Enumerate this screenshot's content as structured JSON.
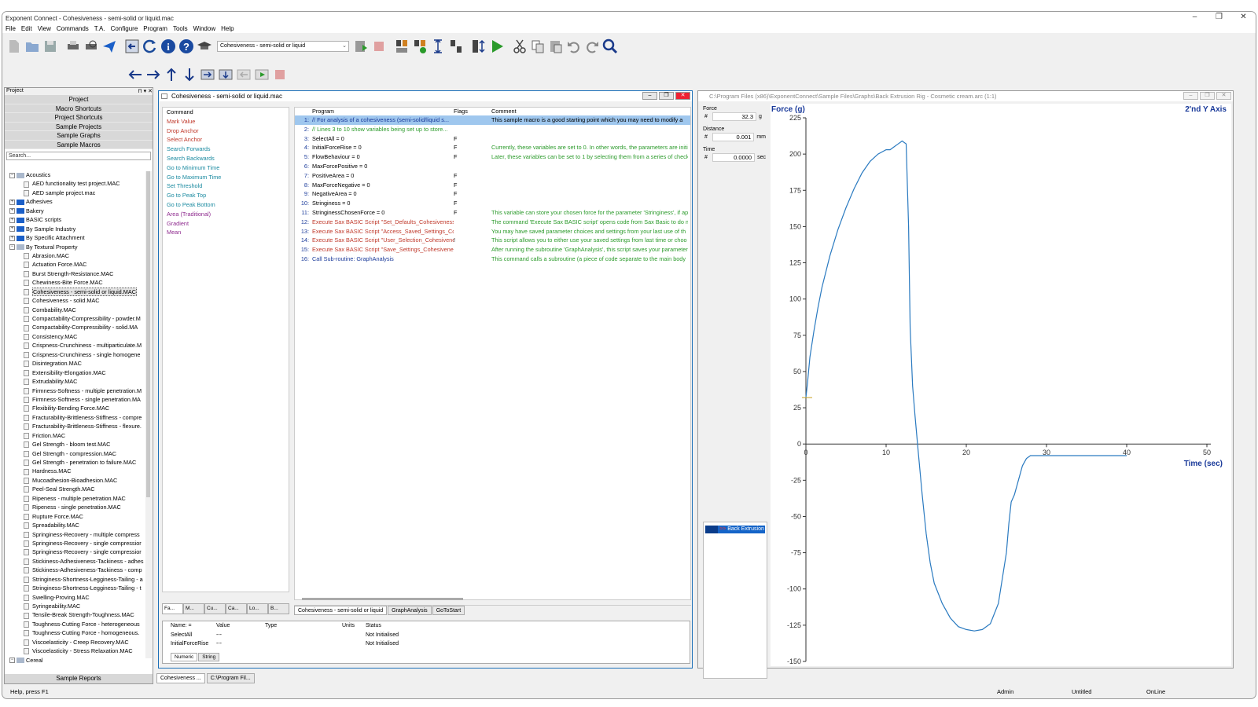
{
  "window": {
    "title": "Exponent Connect - Cohesiveness - semi-solid or liquid.mac"
  },
  "menu": [
    "File",
    "Edit",
    "View",
    "Commands",
    "T.A.",
    "Configure",
    "Program",
    "Tools",
    "Window",
    "Help"
  ],
  "toolbar": {
    "macro_select": "Cohesiveness - semi-solid or liquid"
  },
  "project": {
    "header": "Project",
    "buttons": [
      "Project",
      "Macro Shortcuts",
      "Project Shortcuts",
      "Sample Projects",
      "Sample Graphs",
      "Sample Macros"
    ],
    "search_placeholder": "Search...",
    "tree": [
      {
        "t": "Acoustics",
        "lv": 0,
        "k": "fo"
      },
      {
        "t": "AED functionality test project.MAC",
        "lv": 1,
        "k": "doc"
      },
      {
        "t": "AED sample project.mac",
        "lv": 1,
        "k": "doc"
      },
      {
        "t": "Adhesives",
        "lv": 0,
        "k": "fc"
      },
      {
        "t": "Bakery",
        "lv": 0,
        "k": "fc"
      },
      {
        "t": "BASIC scripts",
        "lv": 0,
        "k": "fc"
      },
      {
        "t": "By Sample Industry",
        "lv": 0,
        "k": "fc"
      },
      {
        "t": "By Specific Attachment",
        "lv": 0,
        "k": "fc"
      },
      {
        "t": "By Textural Property",
        "lv": 0,
        "k": "fo"
      },
      {
        "t": "Abrasion.MAC",
        "lv": 1,
        "k": "doc"
      },
      {
        "t": "Actuation Force.MAC",
        "lv": 1,
        "k": "doc"
      },
      {
        "t": "Burst Strength-Resistance.MAC",
        "lv": 1,
        "k": "doc"
      },
      {
        "t": "Chewiness-Bite Force.MAC",
        "lv": 1,
        "k": "doc"
      },
      {
        "t": "Cohesiveness - semi-solid or liquid.MAC",
        "lv": 1,
        "k": "doc",
        "sel": true
      },
      {
        "t": "Cohesiveness - solid.MAC",
        "lv": 1,
        "k": "doc"
      },
      {
        "t": "Combability.MAC",
        "lv": 1,
        "k": "doc"
      },
      {
        "t": "Compactability-Compressibility - powder.M",
        "lv": 1,
        "k": "doc"
      },
      {
        "t": "Compactability-Compressibility - solid.MA",
        "lv": 1,
        "k": "doc"
      },
      {
        "t": "Consistency.MAC",
        "lv": 1,
        "k": "doc"
      },
      {
        "t": "Crispness-Crunchiness - multiparticulate.M",
        "lv": 1,
        "k": "doc"
      },
      {
        "t": "Crispness-Crunchiness - single homogene",
        "lv": 1,
        "k": "doc"
      },
      {
        "t": "Disintegration.MAC",
        "lv": 1,
        "k": "doc"
      },
      {
        "t": "Extensibility-Elongation.MAC",
        "lv": 1,
        "k": "doc"
      },
      {
        "t": "Extrudability.MAC",
        "lv": 1,
        "k": "doc"
      },
      {
        "t": "Firmness-Softness - multiple penetration.M",
        "lv": 1,
        "k": "doc"
      },
      {
        "t": "Firmness-Softness - single penetration.MA",
        "lv": 1,
        "k": "doc"
      },
      {
        "t": "Flexibility-Bending Force.MAC",
        "lv": 1,
        "k": "doc"
      },
      {
        "t": "Fracturability-Brittleness-Stiffness - compre",
        "lv": 1,
        "k": "doc"
      },
      {
        "t": "Fracturability-Brittleness-Stiffness - flexure.",
        "lv": 1,
        "k": "doc"
      },
      {
        "t": "Friction.MAC",
        "lv": 1,
        "k": "doc"
      },
      {
        "t": "Gel Strength - bloom test.MAC",
        "lv": 1,
        "k": "doc"
      },
      {
        "t": "Gel Strength - compression.MAC",
        "lv": 1,
        "k": "doc"
      },
      {
        "t": "Gel Strength - penetration to failure.MAC",
        "lv": 1,
        "k": "doc"
      },
      {
        "t": "Hardness.MAC",
        "lv": 1,
        "k": "doc"
      },
      {
        "t": "Mucoadhesion-Bioadhesion.MAC",
        "lv": 1,
        "k": "doc"
      },
      {
        "t": "Peel-Seal Strength.MAC",
        "lv": 1,
        "k": "doc"
      },
      {
        "t": "Ripeness - multiple penetration.MAC",
        "lv": 1,
        "k": "doc"
      },
      {
        "t": "Ripeness - single penetration.MAC",
        "lv": 1,
        "k": "doc"
      },
      {
        "t": "Rupture Force.MAC",
        "lv": 1,
        "k": "doc"
      },
      {
        "t": "Spreadability.MAC",
        "lv": 1,
        "k": "doc"
      },
      {
        "t": "Springiness-Recovery - multiple compress",
        "lv": 1,
        "k": "doc"
      },
      {
        "t": "Springiness-Recovery - single compressior",
        "lv": 1,
        "k": "doc"
      },
      {
        "t": "Springiness-Recovery - single compressior",
        "lv": 1,
        "k": "doc"
      },
      {
        "t": "Stickiness-Adhesiveness-Tackiness - adhes",
        "lv": 1,
        "k": "doc"
      },
      {
        "t": "Stickiness-Adhesiveness-Tackiness - comp",
        "lv": 1,
        "k": "doc"
      },
      {
        "t": "Stringiness-Shortness-Legginess-Tailing - a",
        "lv": 1,
        "k": "doc"
      },
      {
        "t": "Stringiness-Shortness-Legginess-Tailing - t",
        "lv": 1,
        "k": "doc"
      },
      {
        "t": "Swelling-Proving.MAC",
        "lv": 1,
        "k": "doc"
      },
      {
        "t": "Syringeability.MAC",
        "lv": 1,
        "k": "doc"
      },
      {
        "t": "Tensile-Break Strength-Toughness.MAC",
        "lv": 1,
        "k": "doc"
      },
      {
        "t": "Toughness-Cutting Force - heterogeneous",
        "lv": 1,
        "k": "doc"
      },
      {
        "t": "Toughness-Cutting Force - homogeneous.",
        "lv": 1,
        "k": "doc"
      },
      {
        "t": "Viscoelasticity - Creep Recovery.MAC",
        "lv": 1,
        "k": "doc"
      },
      {
        "t": "Viscoelasticity - Stress Relaxation.MAC",
        "lv": 1,
        "k": "doc"
      },
      {
        "t": "Cereal",
        "lv": 0,
        "k": "fo"
      },
      {
        "t": "Breakfast cereal - CFR3 OTC.MAC",
        "lv": 1,
        "k": "doc"
      }
    ],
    "footer": "Sample Reports"
  },
  "macro": {
    "title": "Cohesiveness - semi-solid or liquid.mac",
    "commands": [
      {
        "t": "Command",
        "c": "#000000"
      },
      {
        "t": "Mark Value",
        "c": "#c0392b"
      },
      {
        "t": "Drop Anchor",
        "c": "#c0392b"
      },
      {
        "t": "Select Anchor",
        "c": "#c0392b"
      },
      {
        "t": "Search Forwards",
        "c": "#1a8aa0"
      },
      {
        "t": "Search Backwards",
        "c": "#1a8aa0"
      },
      {
        "t": "Go to Minimum Time",
        "c": "#1a8aa0"
      },
      {
        "t": "Go to Maximum Time",
        "c": "#1a8aa0"
      },
      {
        "t": "Set Threshold",
        "c": "#1a8aa0"
      },
      {
        "t": "Go to Peak Top",
        "c": "#1a8aa0"
      },
      {
        "t": "Go to Peak Bottom",
        "c": "#1a8aa0"
      },
      {
        "t": "Area (Traditional)",
        "c": "#8e2a8e"
      },
      {
        "t": "Gradient",
        "c": "#8e2a8e"
      },
      {
        "t": "Mean",
        "c": "#8e2a8e"
      }
    ],
    "cmd_tabs": [
      "Fa...",
      "M...",
      "Cu...",
      "Ca...",
      "Lo...",
      "B..."
    ],
    "prog_headers": {
      "program": "Program",
      "flags": "Flags",
      "comment": "Comment"
    },
    "program": [
      {
        "n": "1:",
        "p": "// For analysis of a cohesiveness (semi-solid/liquid s...",
        "f": "",
        "c": "This sample macro is a good starting point which you may need to modify a",
        "pc": "#1a3a9a",
        "sel": true
      },
      {
        "n": "2:",
        "p": "// Lines 3 to 10 show variables being set up to store...",
        "f": "",
        "c": "",
        "pc": "#2a9a2a"
      },
      {
        "n": "3:",
        "p": "SelectAll = 0",
        "f": "F",
        "c": "",
        "pc": "#000000"
      },
      {
        "n": "4:",
        "p": "InitialForceRise = 0",
        "f": "F",
        "c": "Currently, these variables are set to 0. In other words, the parameters are initi",
        "pc": "#000000"
      },
      {
        "n": "5:",
        "p": "FlowBehaviour = 0",
        "f": "F",
        "c": "Later, these variables can be set to 1 by selecting them from a series of check",
        "pc": "#000000"
      },
      {
        "n": "6:",
        "p": "MaxForcePositive = 0",
        "f": "",
        "c": "",
        "pc": "#000000"
      },
      {
        "n": "7:",
        "p": "PositiveArea = 0",
        "f": "F",
        "c": "",
        "pc": "#000000"
      },
      {
        "n": "8:",
        "p": "MaxForceNegative = 0",
        "f": "F",
        "c": "",
        "pc": "#000000"
      },
      {
        "n": "9:",
        "p": "NegativeArea = 0",
        "f": "F",
        "c": "",
        "pc": "#000000"
      },
      {
        "n": "10:",
        "p": "Stringiness = 0",
        "f": "F",
        "c": "",
        "pc": "#000000"
      },
      {
        "n": "11:",
        "p": "StringinessChosenForce = 0",
        "f": "F",
        "c": "This variable can store your chosen force for the parameter 'Stringiness', if ap",
        "pc": "#000000"
      },
      {
        "n": "12:",
        "p": "Execute Sax BASIC Script \"Set_Defaults_Cohesiveness...",
        "f": "",
        "c": "The command 'Execute Sax BASIC script' opens code from Sax Basic to do m",
        "pc": "#c0392b"
      },
      {
        "n": "13:",
        "p": "Execute Sax BASIC Script \"Access_Saved_Settings_Co...",
        "f": "",
        "c": "You may have saved parameter choices and settings from your last use of th",
        "pc": "#c0392b"
      },
      {
        "n": "14:",
        "p": "Execute Sax BASIC Script \"User_Selection_Cohesivene...",
        "f": "!",
        "c": "This script allows you to either use your saved settings from last time or choo",
        "pc": "#c0392b"
      },
      {
        "n": "15:",
        "p": "Execute Sax BASIC Script \"Save_Settings_Cohesivene...",
        "f": "",
        "c": "After running the subroutine 'GraphAnalysis', this script saves your parameter",
        "pc": "#c0392b"
      },
      {
        "n": "16:",
        "p": "Call Sub-routine: GraphAnalysis",
        "f": "",
        "c": "This command calls a subroutine (a piece of code separate to the main body",
        "pc": "#1a3a9a"
      }
    ],
    "prog_tabs": [
      "Cohesiveness - semi-solid or liquid",
      "GraphAnalysis",
      "GoToStart"
    ],
    "var_headers": [
      "Name: =",
      "Value",
      "Type",
      "Units",
      "Status"
    ],
    "vars": [
      {
        "name": "SelectAll",
        "value": "---",
        "type": "",
        "units": "",
        "status": "Not Initialised"
      },
      {
        "name": "InitialForceRise",
        "value": "---",
        "type": "",
        "units": "",
        "status": "Not Initialised"
      }
    ],
    "var_tabs": [
      "Numeric",
      "String"
    ]
  },
  "graph": {
    "title": "C:\\Program Files (x86)\\ExponentConnect\\Sample Files\\Graphs\\Back Extrusion Rig - Cosmetic cream.arc (1:1)",
    "force": {
      "label": "Force",
      "hash": "#",
      "value": "32.3",
      "unit": "g"
    },
    "distance": {
      "label": "Distance",
      "hash": "#",
      "value": "0.001",
      "unit": "mm"
    },
    "time": {
      "label": "Time",
      "hash": "#",
      "value": "0.0000",
      "unit": "sec"
    },
    "legend": {
      "prefix": ">>",
      "name": "Back Extrusion"
    }
  },
  "chart_data": {
    "type": "line",
    "ylabel": "Force (g)",
    "xlabel": "Time (sec)",
    "y2label": "2'nd Y Axis",
    "xlim": [
      0,
      50
    ],
    "ylim": [
      -150,
      225
    ],
    "xticks": [
      0,
      10,
      20,
      30,
      40,
      50
    ],
    "yticks": [
      -150,
      -125,
      -100,
      -75,
      -50,
      -25,
      0,
      25,
      50,
      75,
      100,
      125,
      150,
      175,
      200,
      225
    ],
    "color": "#2a7ac0",
    "series": [
      {
        "x": [
          0,
          0.2,
          0.5,
          1,
          1.5,
          2,
          3,
          4,
          5,
          6,
          7,
          8,
          9,
          10,
          10.5,
          11,
          11.5,
          12,
          12.5,
          12.8,
          13,
          13.3,
          13.6,
          14,
          14.5,
          15,
          15.5,
          16,
          17,
          18,
          19,
          20,
          21,
          22,
          23,
          24,
          25,
          25.3,
          25.6,
          26,
          26.5,
          27,
          27.5,
          28,
          29,
          30,
          32,
          34,
          36,
          38,
          40
        ],
        "y": [
          32,
          42,
          60,
          78,
          94,
          108,
          130,
          148,
          163,
          176,
          187,
          195,
          200,
          203,
          203,
          205,
          207,
          209,
          207,
          150,
          80,
          40,
          20,
          -5,
          -35,
          -62,
          -82,
          -96,
          -110,
          -120,
          -126,
          -128,
          -129,
          -128,
          -124,
          -110,
          -75,
          -55,
          -40,
          -35,
          -25,
          -15,
          -10,
          -8,
          -8,
          -8,
          -8,
          -8,
          -8,
          -8,
          -8
        ]
      }
    ]
  },
  "bottom_tabs": [
    "Cohesiveness ...",
    "C:\\Program Fil..."
  ],
  "status": {
    "help": "Help, press F1",
    "user": "Admin",
    "doc": "Untitled",
    "conn": "OnLine"
  }
}
